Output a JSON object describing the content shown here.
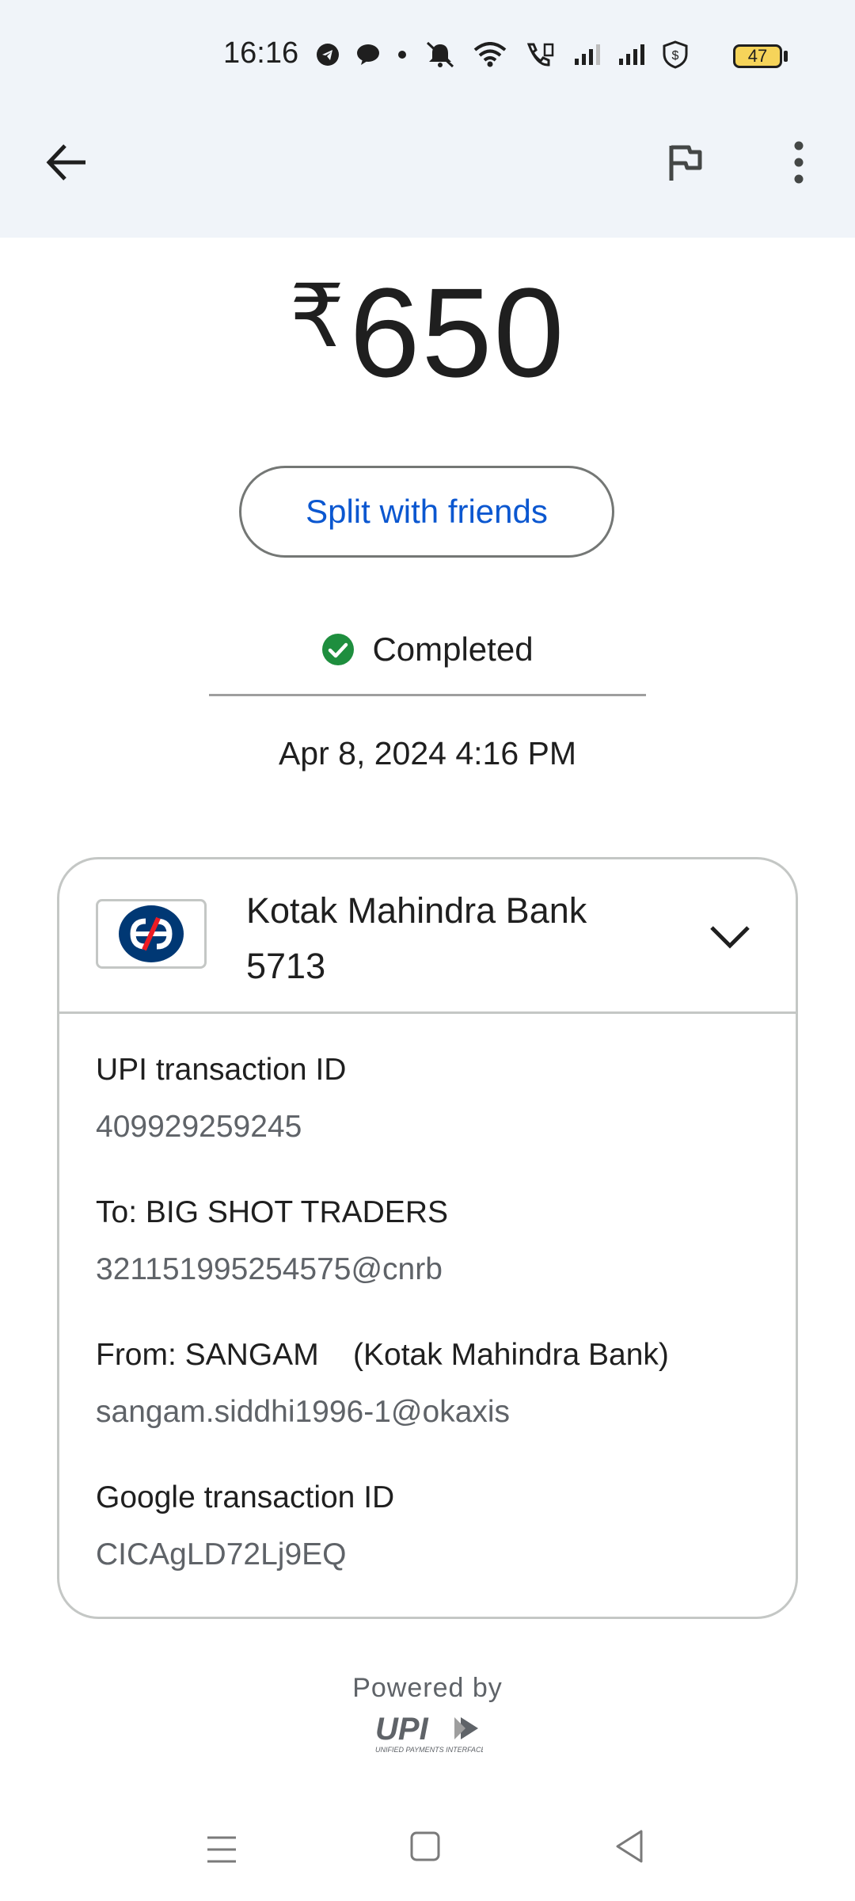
{
  "status_bar": {
    "time": "16:16",
    "battery": "47",
    "icons": [
      "telegram-icon",
      "chat-icon",
      "dot-icon",
      "mute-icon",
      "wifi-icon",
      "call-icon",
      "signal-icon",
      "signal-icon",
      "shield-icon"
    ]
  },
  "header": {
    "back_icon": "arrow-back-icon",
    "flag_icon": "flag-icon",
    "more_icon": "more-vert-icon"
  },
  "transaction": {
    "currency": "₹",
    "amount": "650",
    "split_label": "Split with friends",
    "status": "Completed",
    "datetime": "Apr 8, 2024 4:16 PM"
  },
  "bank": {
    "name": "Kotak Mahindra Bank",
    "account_suffix": "5713"
  },
  "details": {
    "upi_label": "UPI transaction ID",
    "upi_value": "409929259245",
    "to_label": "To: BIG SHOT TRADERS",
    "to_value": "321151995254575@cnrb",
    "from_label": "From: SANGAM    (Kotak Mahindra Bank)",
    "from_value": "sangam.siddhi1996-1@okaxis",
    "google_label": "Google transaction ID",
    "google_value": "CICAgLD72Lj9EQ"
  },
  "footer": {
    "powered_by": "Powered by",
    "upi_logo_text": "UPI",
    "upi_logo_subtext": "UNIFIED PAYMENTS INTERFACE"
  },
  "colors": {
    "accent": "#0b57d0",
    "success": "#1e8e3e",
    "header_bg": "#f0f4f9",
    "kotak_blue": "#003874",
    "kotak_red": "#ed1c24"
  }
}
